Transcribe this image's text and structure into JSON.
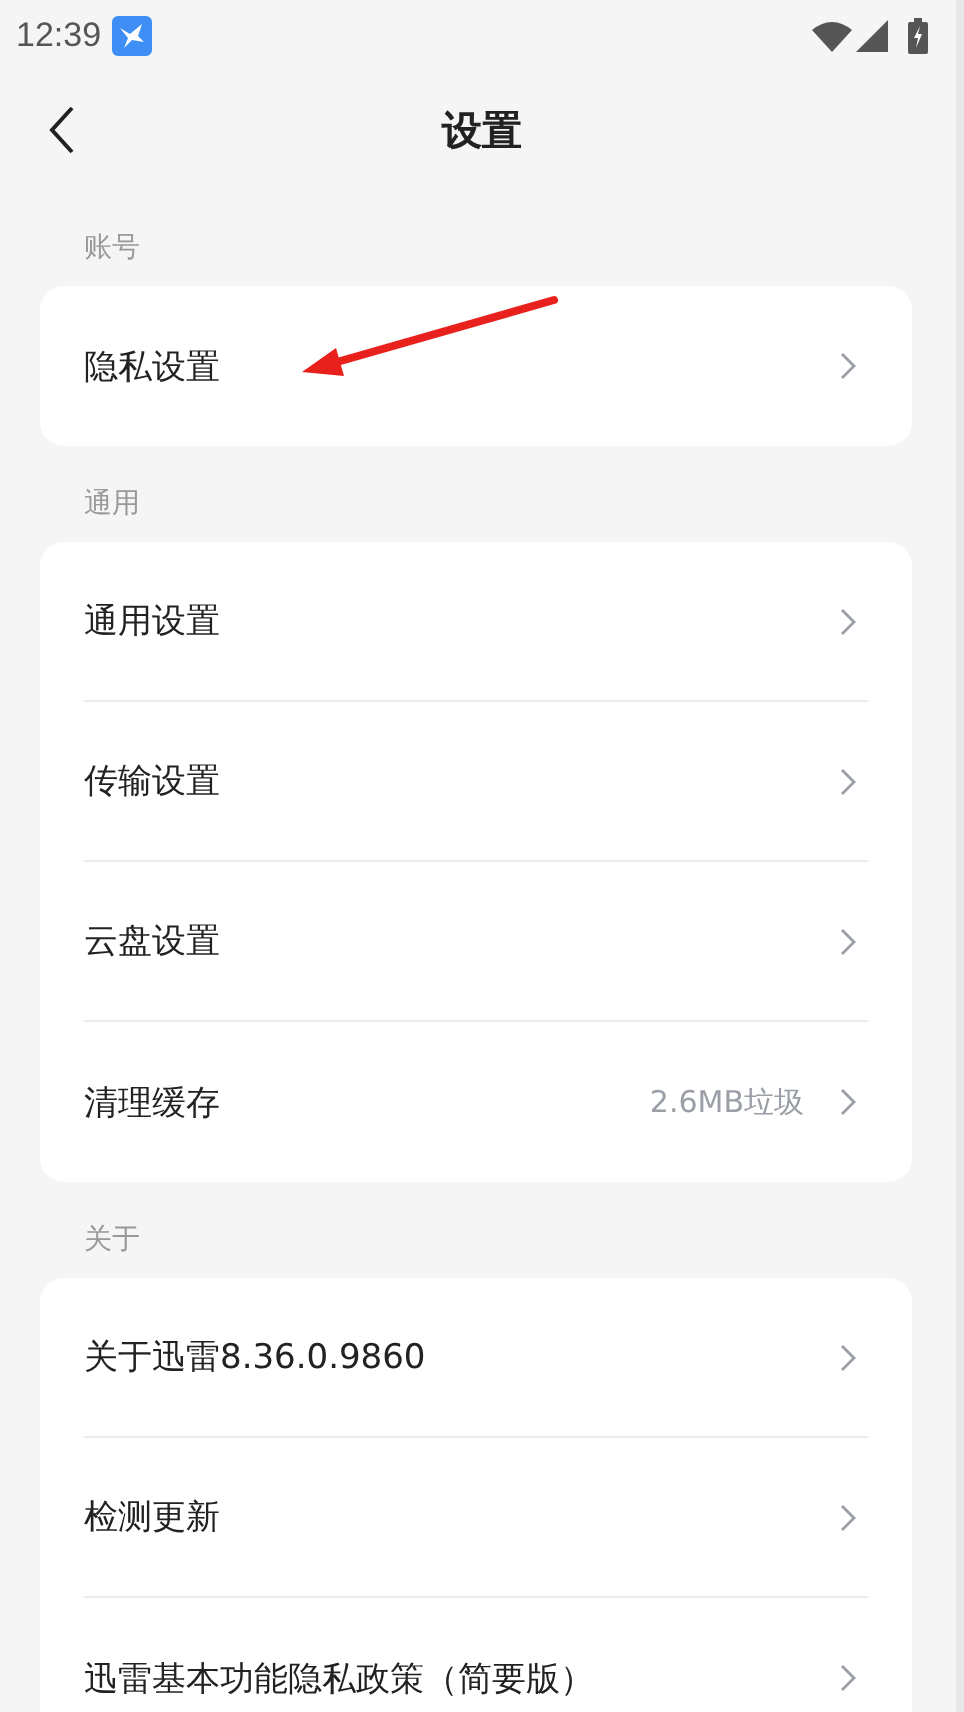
{
  "status_bar": {
    "time": "12:39"
  },
  "header": {
    "title": "设置"
  },
  "sections": [
    {
      "label": "账号",
      "items": [
        {
          "label": "隐私设置"
        }
      ]
    },
    {
      "label": "通用",
      "items": [
        {
          "label": "通用设置"
        },
        {
          "label": "传输设置"
        },
        {
          "label": "云盘设置"
        },
        {
          "label": "清理缓存",
          "value": "2.6MB垃圾"
        }
      ]
    },
    {
      "label": "关于",
      "items": [
        {
          "label": "关于迅雷8.36.0.9860"
        },
        {
          "label": "检测更新"
        },
        {
          "label": "迅雷基本功能隐私政策（简要版）"
        }
      ]
    }
  ]
}
